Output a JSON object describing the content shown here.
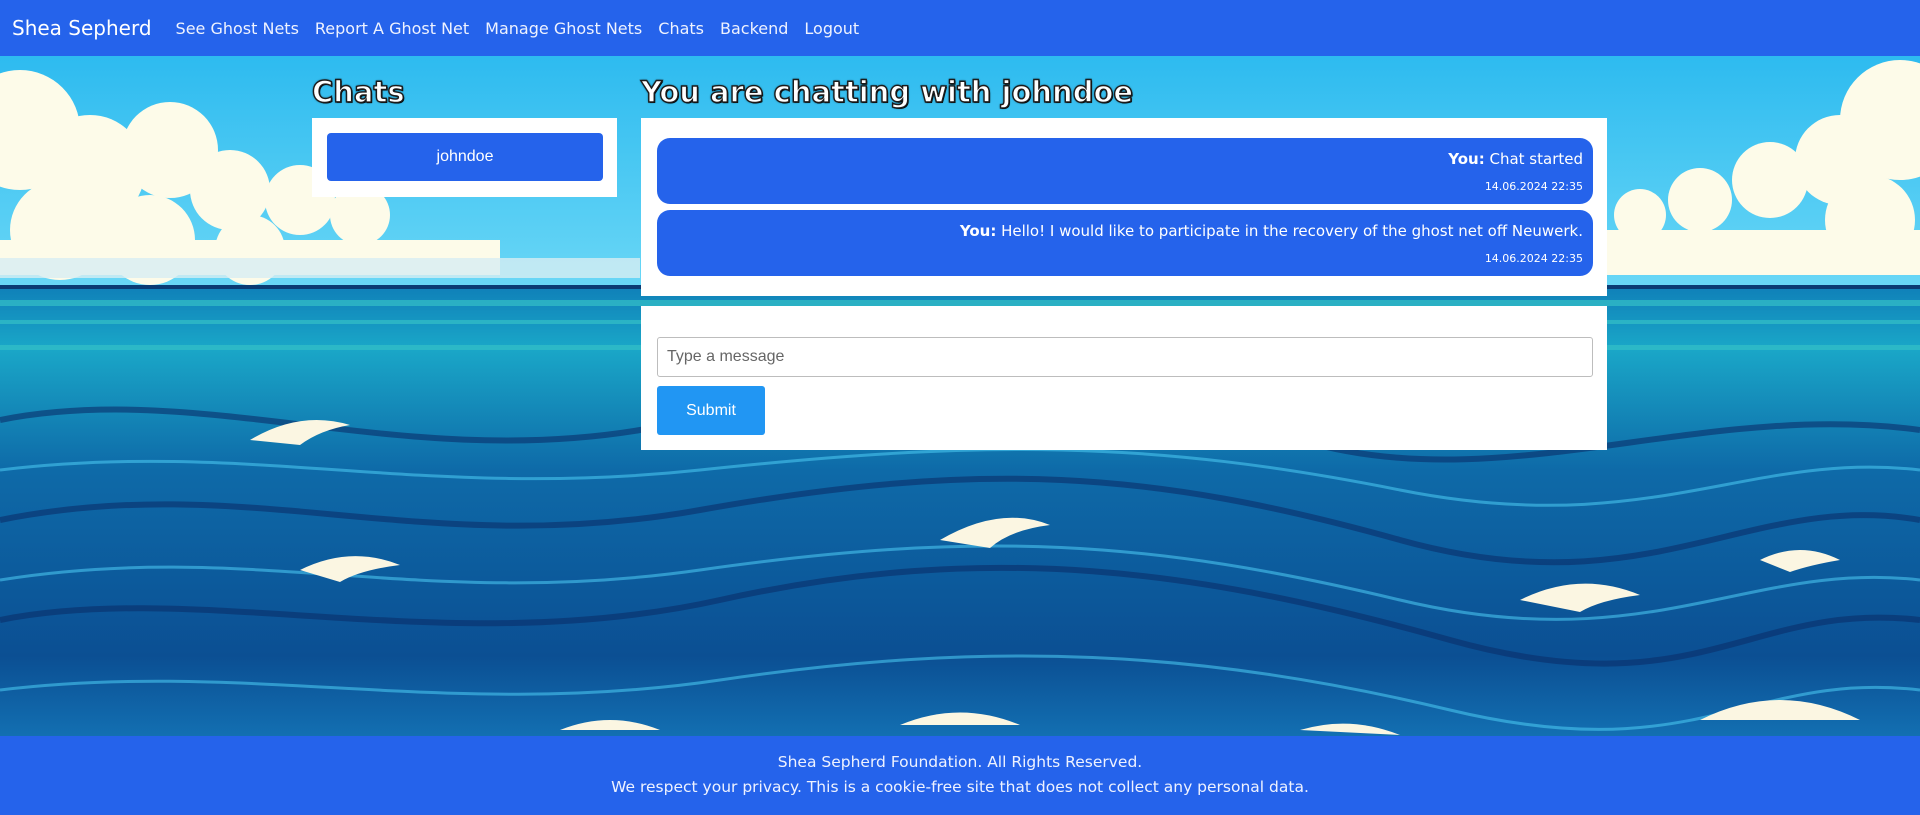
{
  "navbar": {
    "brand": "Shea Sepherd",
    "links": [
      "See Ghost Nets",
      "Report A Ghost Net",
      "Manage Ghost Nets",
      "Chats",
      "Backend",
      "Logout"
    ]
  },
  "sidebar": {
    "heading": "Chats",
    "contacts": [
      "johndoe"
    ]
  },
  "chat": {
    "heading": "You are chatting with johndoe",
    "messages": [
      {
        "sender": "You:",
        "text": "Chat started",
        "time": "14.06.2024 22:35"
      },
      {
        "sender": "You:",
        "text": "Hello! I would like to participate in the recovery of the ghost net off Neuwerk.",
        "time": "14.06.2024 22:35"
      }
    ],
    "input_placeholder": "Type a message",
    "input_value": "",
    "submit_label": "Submit"
  },
  "footer": {
    "line1": "Shea Sepherd Foundation. All Rights Reserved.",
    "line2": "We respect your privacy. This is a cookie-free site that does not collect any personal data."
  },
  "colors": {
    "primary": "#2563eb",
    "submit": "#2196f3",
    "panel": "#ffffff"
  }
}
